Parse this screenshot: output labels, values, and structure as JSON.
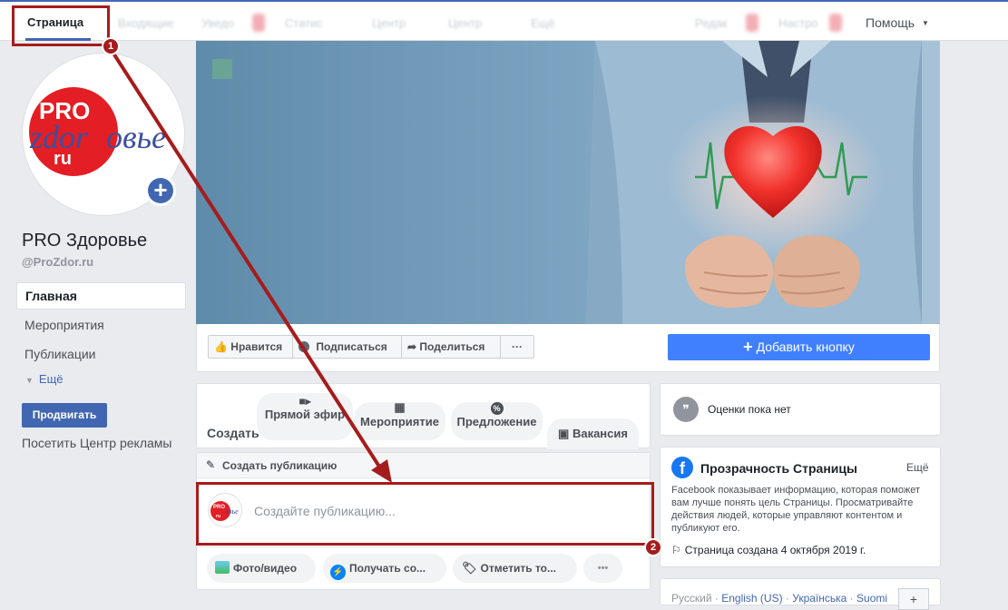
{
  "topbar": {
    "page_tab": "Страница",
    "blurred_tabs": [
      "Входящие",
      "Уведо",
      "Статис",
      "Центр",
      "Центр",
      "Ещё",
      "Редак",
      "Настро"
    ],
    "help": "Помощь"
  },
  "profile": {
    "logo_pro": "PRO",
    "logo_zdor": "zdor",
    "logo_ovie": "овье",
    "logo_ru": "ru",
    "name": "PRO Здоровье",
    "handle": "@ProZdor.ru"
  },
  "nav": {
    "items": [
      "Главная",
      "Мероприятия",
      "Публикации"
    ],
    "more": "Ещё",
    "promote": "Продвигать",
    "ads_center": "Посетить Центр рекламы"
  },
  "actions": {
    "like": "Нравится",
    "follow": "Подписаться",
    "share": "Поделиться",
    "more": "···",
    "add_button": "Добавить кнопку"
  },
  "create": {
    "label": "Создать",
    "live": "Прямой эфир",
    "event": "Мероприятие",
    "offer": "Предложение",
    "job": "Вакансия"
  },
  "composer": {
    "header": "Создать публикацию",
    "placeholder": "Создайте публикацию...",
    "photo": "Фото/видео",
    "get_messages": "Получать со...",
    "tag": "Отметить то...",
    "more": "•••"
  },
  "right": {
    "ratings": "Оценки пока нет",
    "transparency_title": "Прозрачность Страницы",
    "transparency_more": "Ещё",
    "transparency_text": "Facebook показывает информацию, которая поможет вам лучше понять цель Страницы. Просматривайте действия людей, которые управляют контентом и публикуют его.",
    "created": "Страница создана 4 октября 2019 г.",
    "languages": [
      "Русский",
      "English (US)",
      "Українська",
      "Suomi"
    ],
    "lang_sep": "·",
    "lang_add": "+"
  },
  "annotations": {
    "one": "1",
    "two": "2"
  },
  "colors": {
    "accent": "#4267b2",
    "add_button": "#4080ff",
    "annotation": "#a51c1c"
  }
}
